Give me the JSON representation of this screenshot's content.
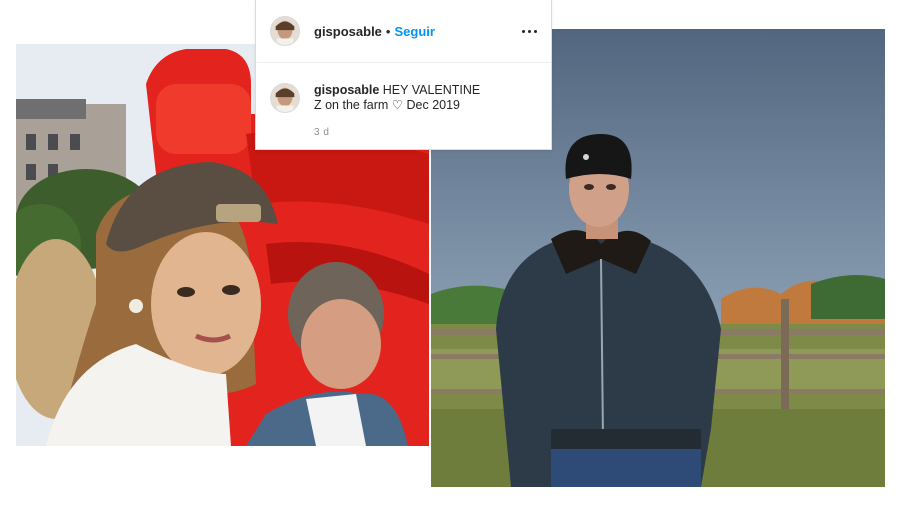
{
  "post": {
    "username": "gisposable",
    "separator": "•",
    "follow_label": "Seguir",
    "more_icon": "more-horizontal-icon",
    "caption_user": "gisposable",
    "caption_line1": "HEY VALENTINE",
    "caption_line2": "Z on the farm ♡ Dec 2019",
    "time": "3 d"
  },
  "colors": {
    "follow_blue": "#0095f6",
    "text": "#262626",
    "muted": "#8e8e8e",
    "border": "#dbdbdb",
    "inflatable_red": "#e3231d",
    "sky_blue": "#5d7189"
  }
}
